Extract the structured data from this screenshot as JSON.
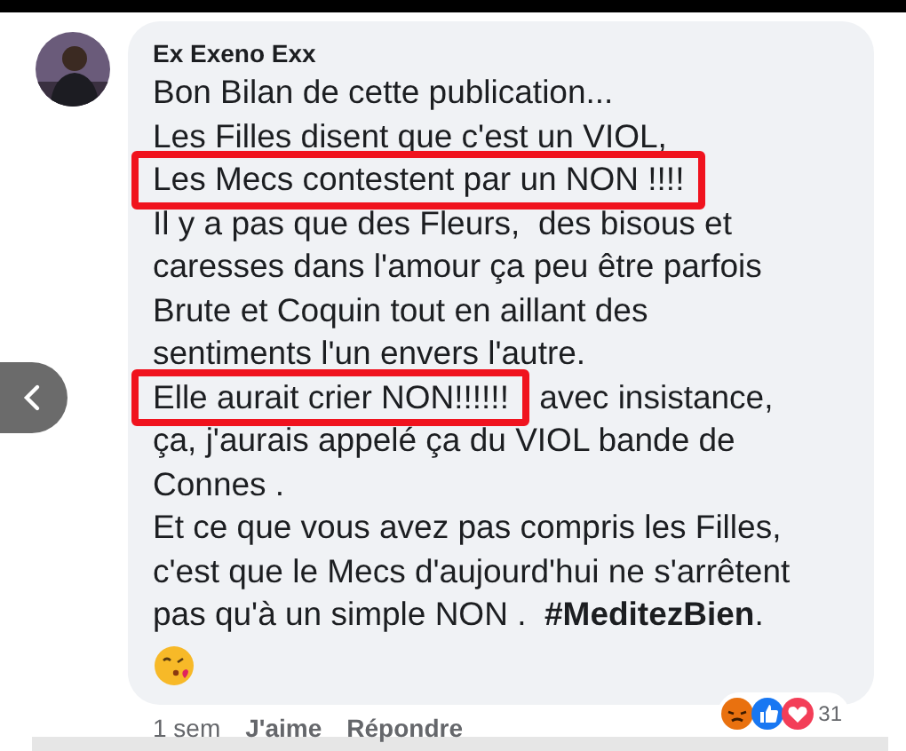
{
  "comment": {
    "author": "Ex Exeno Exx",
    "lines": [
      [
        {
          "text": "Bon Bilan de cette publication...",
          "marked": false
        }
      ],
      [
        {
          "text": "Les Filles disent que c'est un VIOL,",
          "marked": false
        }
      ],
      [
        {
          "text": "Les Mecs contestent par un NON !!!!",
          "marked": true
        }
      ],
      [
        {
          "text": "Il y a pas que des Fleurs,  des bisous et",
          "marked": false
        }
      ],
      [
        {
          "text": "caresses dans l'amour ça peu être parfois",
          "marked": false
        }
      ],
      [
        {
          "text": "Brute et Coquin tout en aillant des",
          "marked": false
        }
      ],
      [
        {
          "text": "sentiments l'un envers l'autre.",
          "marked": false
        }
      ],
      [
        {
          "text": "Elle aurait crier NON!!!!!!",
          "marked": true
        },
        {
          "text": " avec insistance,",
          "marked": false
        }
      ],
      [
        {
          "text": "ça, j'aurais appelé ça du VIOL bande de",
          "marked": false
        }
      ],
      [
        {
          "text": "Connes .",
          "marked": false
        }
      ],
      [
        {
          "text": "Et ce que vous avez pas compris les Filles,",
          "marked": false
        }
      ],
      [
        {
          "text": "c'est que le Mecs d'aujourd'hui ne s'arrêtent",
          "marked": false
        }
      ],
      [
        {
          "text": "pas qu'à un simple NON .  **#MeditezBien**.",
          "marked": false
        }
      ]
    ],
    "time": "1 sem",
    "actions": [
      "J'aime",
      "Répondre"
    ],
    "reaction_count": "31"
  }
}
